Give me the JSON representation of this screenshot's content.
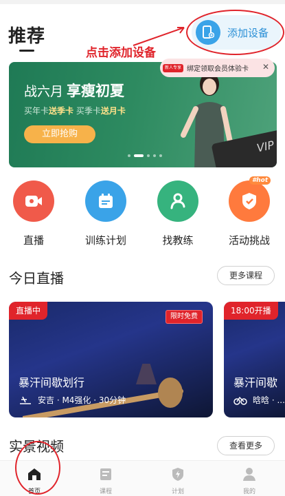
{
  "header": {
    "title": "推荐",
    "add_device_label": "添加设备",
    "annotation": "点击添加设备"
  },
  "banner": {
    "title_part1": "战六月",
    "title_part2": "享瘦初夏",
    "sub_prefix1": "买年卡",
    "sub_bold1": "送季卡",
    "sub_prefix2": "买季卡",
    "sub_bold2": "送月卡",
    "cta": "立即抢购",
    "card_text": "VIP"
  },
  "popup": {
    "badge": "新人专享",
    "text": "绑定领取会员体验卡",
    "close_icon": "✕"
  },
  "quick_actions": [
    {
      "label": "直播",
      "icon": "live-camera-icon",
      "color": "#f05a4a"
    },
    {
      "label": "训练计划",
      "icon": "calendar-icon",
      "color": "#3aa3e8"
    },
    {
      "label": "找教练",
      "icon": "coach-icon",
      "color": "#36b37e"
    },
    {
      "label": "活动挑战",
      "icon": "shield-icon",
      "color": "#ff7a3d",
      "badge": "#hot"
    }
  ],
  "today_live": {
    "title": "今日直播",
    "more": "更多课程",
    "cards": [
      {
        "status": "直播中",
        "tag": "限时免费",
        "title": "暴汗间歇划行",
        "meta": "安吉 · M4强化 · 30分钟"
      },
      {
        "status": "18:00开播",
        "title": "暴汗间歇",
        "meta": "晗晗 · ..."
      }
    ]
  },
  "videos": {
    "title": "实景视频",
    "more": "查看更多"
  },
  "tabbar": {
    "items": [
      {
        "label": "首页",
        "active": true
      },
      {
        "label": "课程",
        "active": false
      },
      {
        "label": "计划",
        "active": false
      },
      {
        "label": "我的",
        "active": false
      }
    ]
  },
  "colors": {
    "accent_red": "#e0242b",
    "accent_blue": "#3aa3e8",
    "banner_green": "#2d8a60"
  }
}
